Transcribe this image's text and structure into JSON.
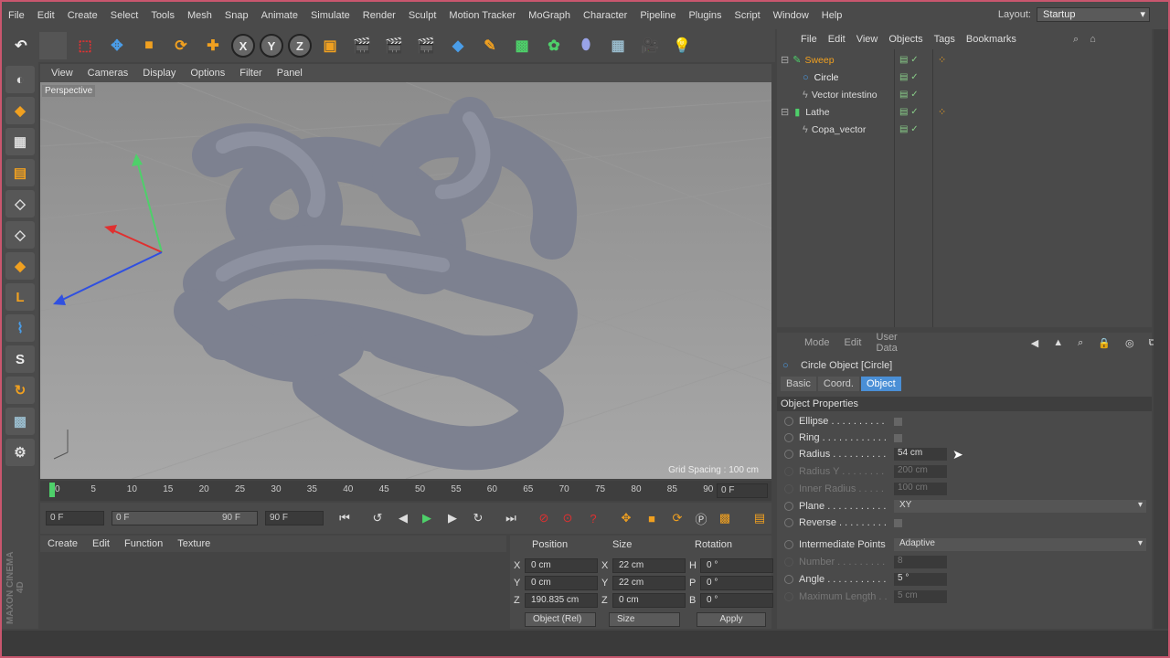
{
  "menu": [
    "File",
    "Edit",
    "Create",
    "Select",
    "Tools",
    "Mesh",
    "Snap",
    "Animate",
    "Simulate",
    "Render",
    "Sculpt",
    "Motion Tracker",
    "MoGraph",
    "Character",
    "Pipeline",
    "Plugins",
    "Script",
    "Window",
    "Help"
  ],
  "layout": {
    "label": "Layout:",
    "value": "Startup"
  },
  "viewport": {
    "menu": [
      "View",
      "Cameras",
      "Display",
      "Options",
      "Filter",
      "Panel"
    ],
    "name": "Perspective",
    "grid_spacing": "Grid Spacing : 100 cm"
  },
  "timeline": {
    "ticks": [
      "0",
      "5",
      "10",
      "15",
      "20",
      "25",
      "30",
      "35",
      "40",
      "45",
      "50",
      "55",
      "60",
      "65",
      "70",
      "75",
      "80",
      "85",
      "90"
    ],
    "frame_field": "0 F",
    "start": "0 F",
    "slider_start": "0 F",
    "slider_end": "90 F",
    "end": "90 F"
  },
  "material_menu": [
    "Create",
    "Edit",
    "Function",
    "Texture"
  ],
  "coords": {
    "headers": [
      "Position",
      "Size",
      "Rotation"
    ],
    "rows": [
      {
        "a": "X",
        "pos": "0 cm",
        "b": "X",
        "size": "22 cm",
        "c": "H",
        "rot": "0 °"
      },
      {
        "a": "Y",
        "pos": "0 cm",
        "b": "Y",
        "size": "22 cm",
        "c": "P",
        "rot": "0 °"
      },
      {
        "a": "Z",
        "pos": "190.835 cm",
        "b": "Z",
        "size": "0 cm",
        "c": "B",
        "rot": "0 °"
      }
    ],
    "mode": "Object (Rel)",
    "size_mode": "Size",
    "apply": "Apply"
  },
  "objects": {
    "menu": [
      "File",
      "Edit",
      "View",
      "Objects",
      "Tags",
      "Bookmarks"
    ],
    "items": [
      {
        "name": "Sweep"
      },
      {
        "name": "Circle"
      },
      {
        "name": "Vector intestino"
      },
      {
        "name": "Lathe"
      },
      {
        "name": "Copa_vector"
      }
    ]
  },
  "attributes": {
    "menu": [
      "Mode",
      "Edit",
      "User Data"
    ],
    "title": "Circle Object [Circle]",
    "tabs": [
      "Basic",
      "Coord.",
      "Object"
    ],
    "section": "Object Properties",
    "props": [
      {
        "label": "Ellipse . . . . . . . . . ."
      },
      {
        "label": "Ring . . . . . . . . . . . ."
      },
      {
        "label": "Radius . . . . . . . . . .",
        "value": "54 cm"
      },
      {
        "label": "Radius Y . . . . . . . .",
        "value": "200 cm"
      },
      {
        "label": "Inner Radius . . . . .",
        "value": "100 cm"
      },
      {
        "label": "Plane . . . . . . . . . . .",
        "value": "XY"
      },
      {
        "label": "Reverse . . . . . . . . ."
      }
    ],
    "points": {
      "label": "Intermediate Points",
      "value": "Adaptive"
    },
    "number": {
      "label": "Number . . . . . . . . .",
      "value": "8"
    },
    "angle": {
      "label": "Angle . . . . . . . . . . .",
      "value": "5 °"
    },
    "maxlen": {
      "label": "Maximum Length . .",
      "value": "5 cm"
    }
  },
  "brand": "MAXON CINEMA 4D"
}
